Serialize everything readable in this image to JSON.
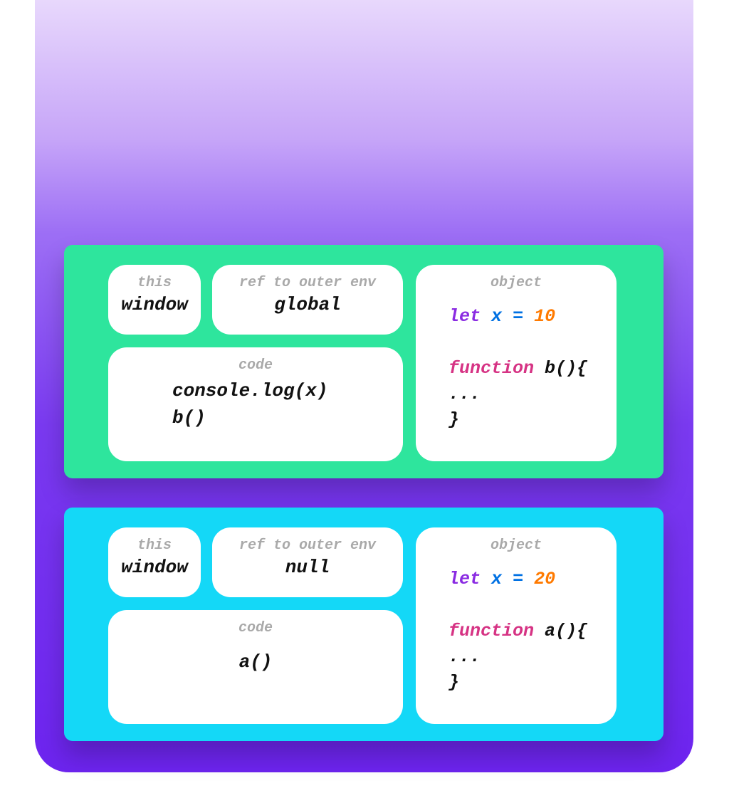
{
  "labels": {
    "this": "this",
    "ref": "ref to outer env",
    "code": "code",
    "object": "object"
  },
  "contexts": [
    {
      "color": "green",
      "this": "window",
      "ref": "global",
      "code": [
        "console.log(x)",
        "b()"
      ],
      "object": {
        "let_var": "x",
        "let_val": "10",
        "func_name": "b"
      }
    },
    {
      "color": "cyan",
      "this": "window",
      "ref": "null",
      "code": [
        "a()"
      ],
      "object": {
        "let_var": "x",
        "let_val": "20",
        "func_name": "a"
      }
    }
  ]
}
